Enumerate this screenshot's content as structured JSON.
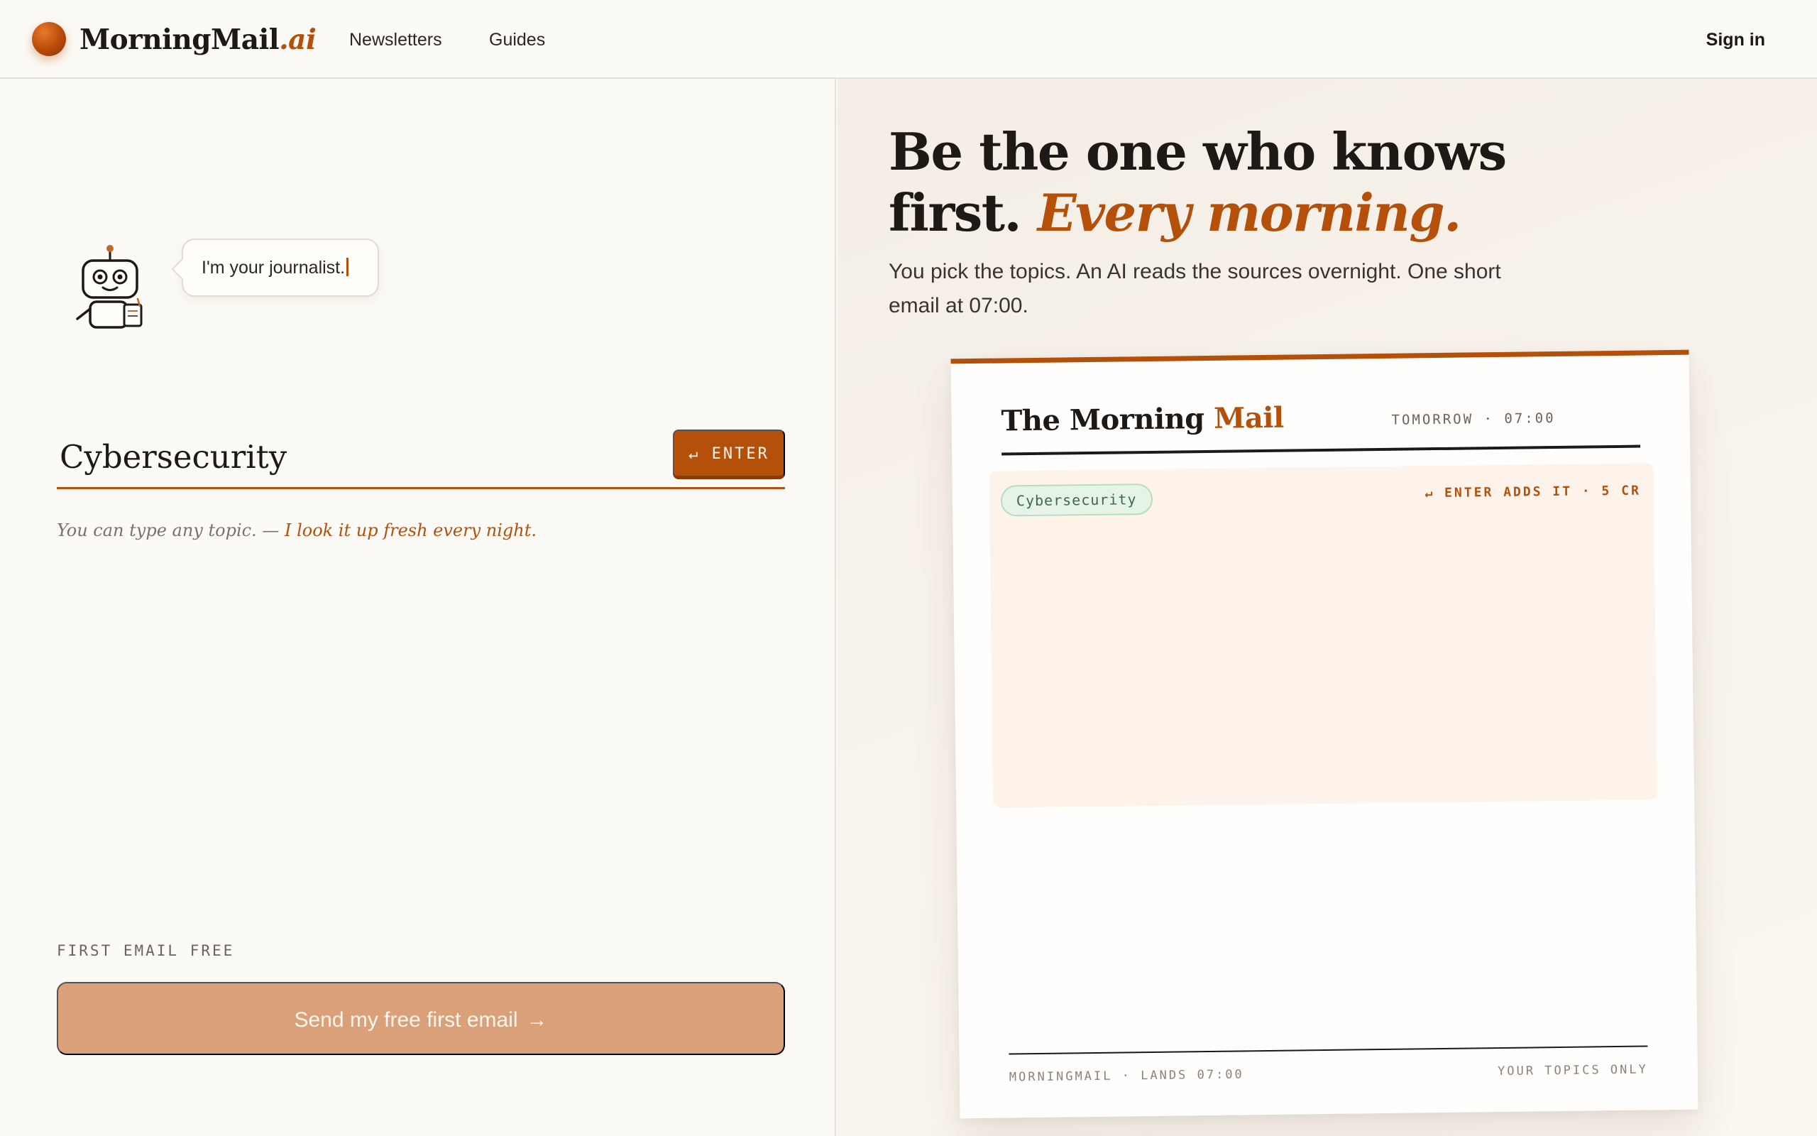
{
  "header": {
    "brand_name": "MorningMail",
    "brand_suffix": ".ai",
    "nav": {
      "newsletters": "Newsletters",
      "guides": "Guides"
    },
    "sign_in": "Sign in"
  },
  "composer": {
    "bubble_text": "I'm your journalist.",
    "topic_value": "Cybersecurity",
    "enter_label": "↵ ENTER",
    "hint_prefix": "You can type any topic. —",
    "hint_accent": "I look it up fresh every night.",
    "free_label": "FIRST EMAIL FREE",
    "cta_label": "Send my free first email",
    "cta_arrow": "→"
  },
  "hero": {
    "headline_line1": "Be the one who knows",
    "headline_line2": "first.",
    "headline_accent": "Every morning.",
    "subhead": "You pick the topics. An AI reads the sources overnight. One short email at 07:00."
  },
  "preview": {
    "title": "The Morning",
    "title_accent": "Mail",
    "schedule": "TOMORROW · 07:00",
    "topic_chip": "Cybersecurity",
    "drop_hint": "↵ ENTER ADDS IT · 5 CR",
    "footer_left": "MORNINGMAIL · LANDS 07:00",
    "footer_right": "YOUR TOPICS ONLY"
  },
  "colors": {
    "accent": "#b4500a",
    "background": "#fcfaf6",
    "cta_disabled": "#d9a07a",
    "chip_green": "#e6f4e8"
  },
  "icons": {
    "logo": "orange-sphere-icon",
    "mascot": "robot-icon",
    "enter": "return-key-icon",
    "cta": "arrow-right-icon"
  }
}
